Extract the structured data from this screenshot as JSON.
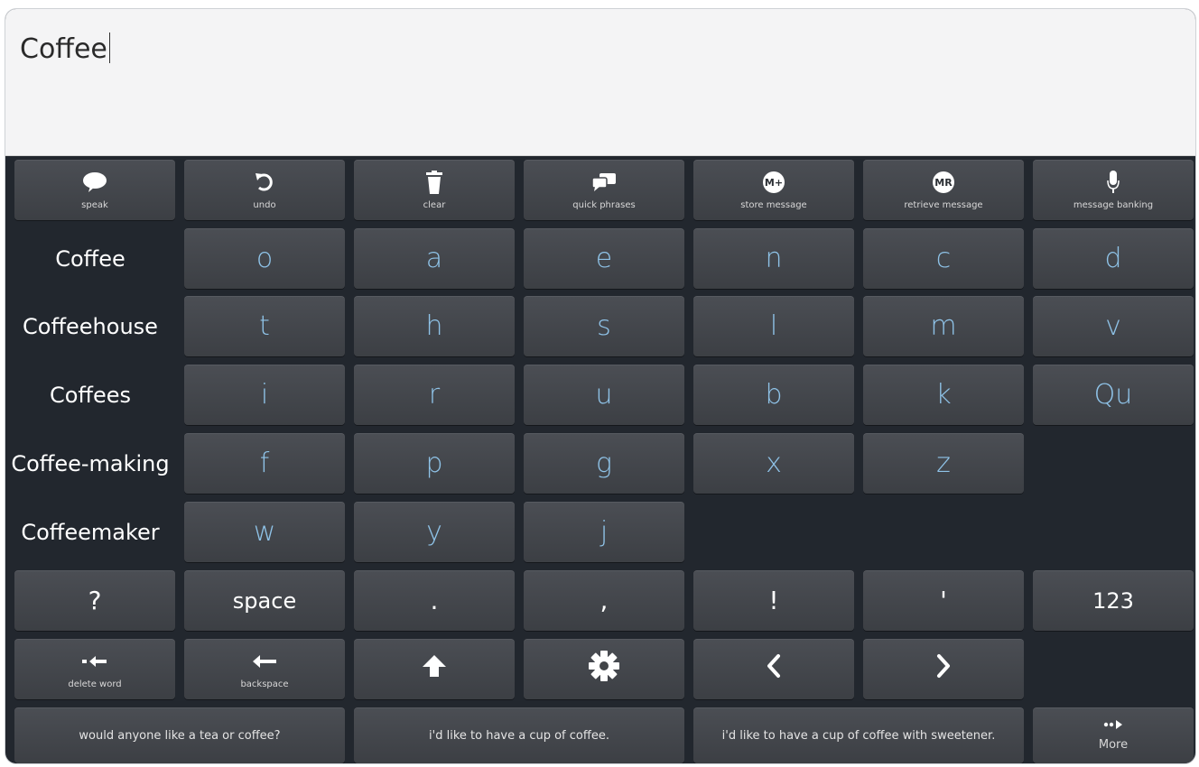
{
  "text_area": {
    "message": "Coffee"
  },
  "toolbar": {
    "speak": "speak",
    "undo": "undo",
    "clear": "clear",
    "quick_phrases": "quick phrases",
    "store_message": "store message",
    "store_badge": "M+",
    "retrieve_message": "retrieve message",
    "retrieve_badge": "MR",
    "message_banking": "message banking"
  },
  "predictions": [
    "Coffee",
    "Coffeehouse",
    "Coffees",
    "Coffee-making",
    "Coffeemaker"
  ],
  "letters": {
    "row1": [
      "o",
      "a",
      "e",
      "n",
      "c",
      "d"
    ],
    "row2": [
      "t",
      "h",
      "s",
      "l",
      "m",
      "v"
    ],
    "row3": [
      "i",
      "r",
      "u",
      "b",
      "k",
      "Qu"
    ],
    "row4": [
      "f",
      "p",
      "g",
      "x",
      "z"
    ],
    "row5": [
      "w",
      "y",
      "j"
    ]
  },
  "punct_row": [
    "?",
    "space",
    ".",
    ",",
    "!",
    "'",
    "123"
  ],
  "controls": {
    "delete_word": "delete word",
    "backspace": "backspace"
  },
  "phrases": [
    "would anyone like a tea or coffee?",
    "i'd like to have a cup of coffee.",
    "i'd like to have a cup of coffee with sweetener."
  ],
  "more": "More",
  "colors": {
    "letter": "#8fc3e8",
    "key_bg": "#44474c",
    "panel_bg": "#22272e"
  }
}
